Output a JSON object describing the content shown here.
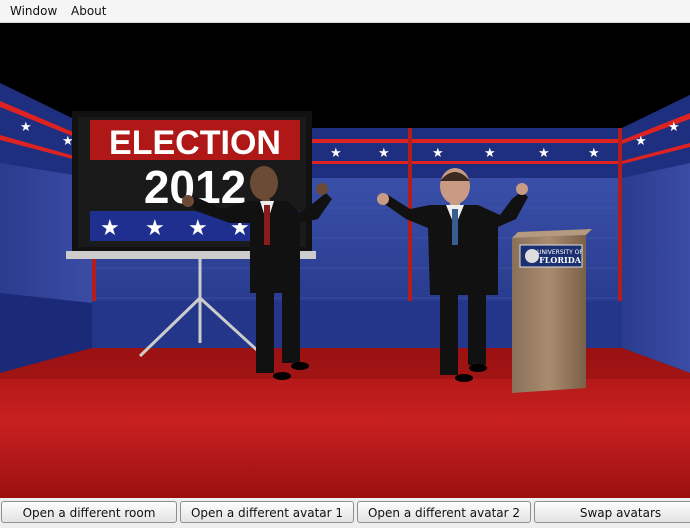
{
  "menu": {
    "items": [
      "Window",
      "About"
    ]
  },
  "scene": {
    "banner": {
      "line1": "ELECTION",
      "line2": "2012"
    },
    "podium": {
      "seal_text_top": "UNIVERSITY OF",
      "seal_text_bottom": "FLORIDA"
    },
    "colors": {
      "stage_blue": "#2e3f8f",
      "stage_red": "#b01818",
      "floor_red": "#c21d1d"
    }
  },
  "buttons": {
    "open_room": "Open a different room",
    "open_avatar1": "Open a different avatar 1",
    "open_avatar2": "Open a different avatar 2",
    "swap": "Swap avatars"
  }
}
